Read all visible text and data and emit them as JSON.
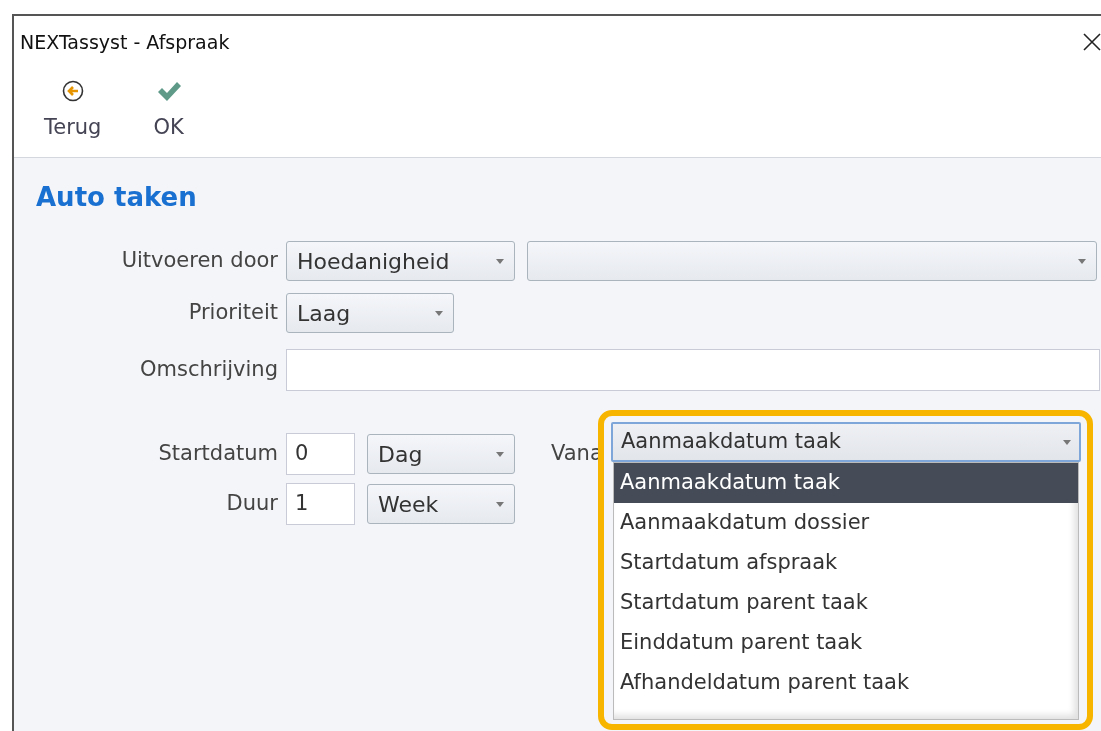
{
  "window": {
    "title": "NEXTassyst - Afspraak"
  },
  "toolbar": [
    {
      "kind": "back",
      "label": "Terug"
    },
    {
      "kind": "ok",
      "label": "OK"
    }
  ],
  "section_title": "Auto taken",
  "form": {
    "uitvoeren_door": {
      "label": "Uitvoeren door",
      "value": "Hoedanigheid"
    },
    "prioriteit": {
      "label": "Prioriteit",
      "value": "Laag"
    },
    "omschrijving": {
      "label": "Omschrijving"
    },
    "startdatum": {
      "label": "Startdatum",
      "value": "0",
      "unit": "Dag"
    },
    "duur": {
      "label": "Duur",
      "value": "1",
      "unit": "Week"
    },
    "vanaf": {
      "label": "Vana",
      "value": "Aanmaakdatum taak",
      "expanded": true,
      "options": [
        {
          "label": "Aanmaakdatum taak",
          "selected": true
        },
        {
          "label": "Aanmaakdatum dossier",
          "selected": false
        },
        {
          "label": "Startdatum afspraak",
          "selected": false
        },
        {
          "label": "Startdatum parent taak",
          "selected": false
        },
        {
          "label": "Einddatum parent taak",
          "selected": false
        },
        {
          "label": "Afhandeldatum parent taak",
          "selected": false
        }
      ]
    }
  }
}
